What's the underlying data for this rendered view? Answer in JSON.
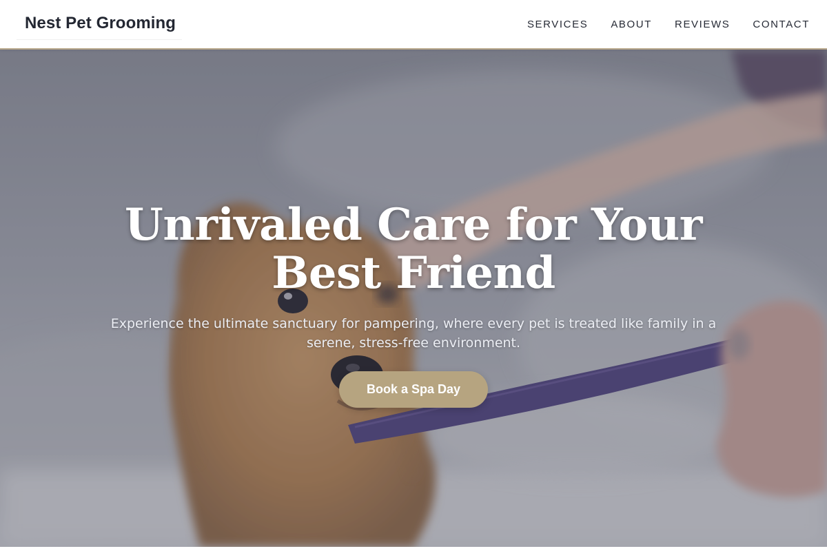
{
  "header": {
    "logo": "Nest Pet Grooming",
    "nav": [
      "SERVICES",
      "ABOUT",
      "REVIEWS",
      "CONTACT"
    ]
  },
  "hero": {
    "title_line1": "Unrivaled Care for Your",
    "title_line2": "Best Friend",
    "subtitle": "Experience the ultimate sanctuary for pampering, where every pet is treated like family in a serene, stress-free environment.",
    "cta": "Book a Spa Day",
    "background_image": "wet-dog-on-leash-photo"
  },
  "colors": {
    "accent": "#b6a480",
    "header_border": "#b8a78a",
    "text_dark": "#232732",
    "overlay": "#464a5c",
    "leash": "#4d3f7a"
  }
}
